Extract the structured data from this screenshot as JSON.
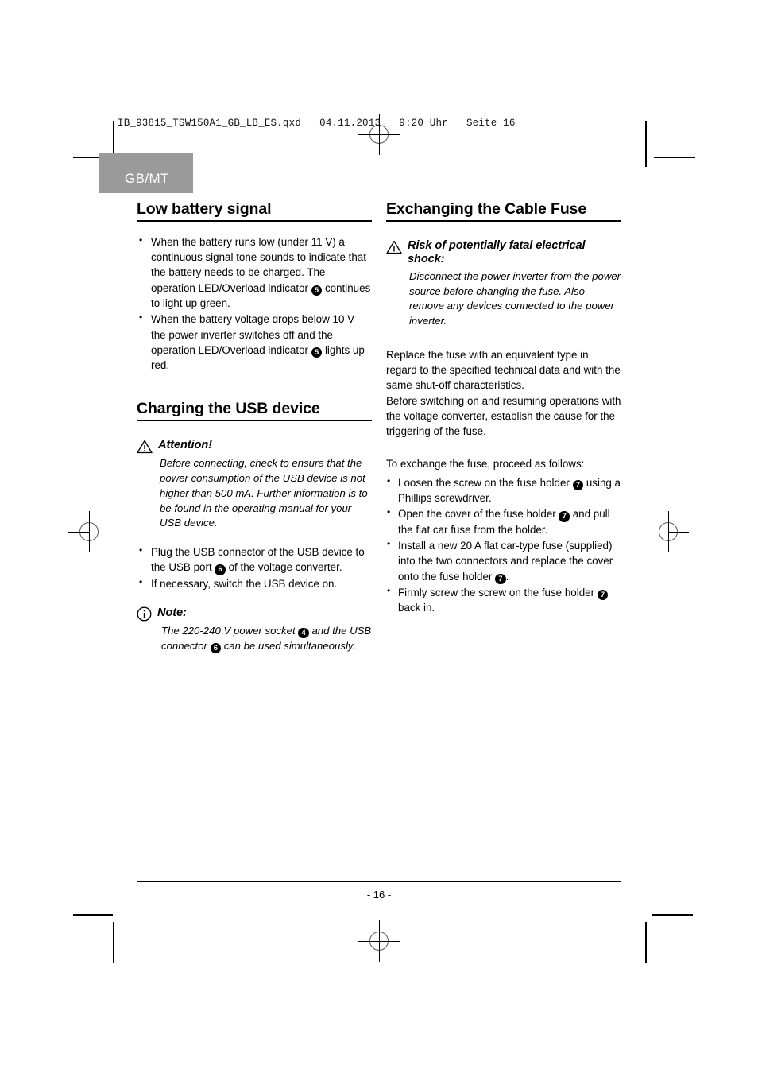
{
  "print_header": "IB_93815_TSW150A1_GB_LB_ES.qxd   04.11.2013   9:20 Uhr   Seite 16",
  "language_tab": "GB/MT",
  "left_column": {
    "section1": {
      "heading": "Low battery signal",
      "bullets": [
        {
          "parts": [
            {
              "t": "text",
              "v": "When the battery runs low (under 11 V) a continuous signal tone sounds to indicate that the battery needs to be charged. The operation LED/Overload indicator "
            },
            {
              "t": "badge",
              "v": "5"
            },
            {
              "t": "text",
              "v": " continues to light up green."
            }
          ]
        },
        {
          "parts": [
            {
              "t": "text",
              "v": "When the battery voltage drops below 10 V the power inverter switches off and the operation LED/Overload indicator "
            },
            {
              "t": "badge",
              "v": "5"
            },
            {
              "t": "text",
              "v": " lights up red."
            }
          ]
        }
      ]
    },
    "section2": {
      "heading": "Charging the USB device",
      "attention": {
        "icon": "warning-triangle-icon",
        "title": "Attention!",
        "body": "Before connecting, check to ensure that the power consumption of the USB device is not higher than 500 mA. Further information is to be found in the operating manual for your USB device."
      },
      "bullets": [
        {
          "parts": [
            {
              "t": "text",
              "v": "Plug the USB connector of the USB device to the USB port "
            },
            {
              "t": "badge",
              "v": "6"
            },
            {
              "t": "text",
              "v": " of the voltage converter."
            }
          ]
        },
        {
          "parts": [
            {
              "t": "text",
              "v": "If necessary, switch the USB device on."
            }
          ]
        }
      ],
      "note": {
        "icon": "info-circle-icon",
        "title": "Note:",
        "parts": [
          {
            "t": "text",
            "v": "The 220-240 V power socket "
          },
          {
            "t": "badge",
            "v": "4"
          },
          {
            "t": "text",
            "v": " and the USB connector "
          },
          {
            "t": "badge",
            "v": "6"
          },
          {
            "t": "text",
            "v": " can be used simultaneously."
          }
        ]
      }
    }
  },
  "right_column": {
    "heading": "Exchanging the Cable Fuse",
    "warning": {
      "icon": "warning-triangle-icon",
      "title": "Risk of potentially fatal electrical shock:",
      "body": "Disconnect the power inverter from the power source before changing the fuse. Also remove any devices connected to the power inverter."
    },
    "paragraphs": [
      "Replace the fuse with an equivalent type in regard to the specified technical data and with the same shut-off characteristics.",
      "Before switching on and resuming operations with the voltage converter, establish the cause for the triggering of the fuse.",
      "To exchange the fuse, proceed as follows:"
    ],
    "bullets": [
      {
        "parts": [
          {
            "t": "text",
            "v": "Loosen the screw on the fuse holder "
          },
          {
            "t": "badge",
            "v": "7"
          },
          {
            "t": "text",
            "v": " using a Phillips screwdriver."
          }
        ]
      },
      {
        "parts": [
          {
            "t": "text",
            "v": "Open the cover of the fuse holder "
          },
          {
            "t": "badge",
            "v": "7"
          },
          {
            "t": "text",
            "v": " and pull the flat car fuse from the holder."
          }
        ]
      },
      {
        "parts": [
          {
            "t": "text",
            "v": "Install a new 20 A flat car-type fuse (supplied) into the two connectors and replace the cover onto the fuse holder "
          },
          {
            "t": "badge",
            "v": "7"
          },
          {
            "t": "text",
            "v": "."
          }
        ]
      },
      {
        "parts": [
          {
            "t": "text",
            "v": "Firmly screw the screw on the fuse holder "
          },
          {
            "t": "badge",
            "v": "7"
          },
          {
            "t": "text",
            "v": " back in."
          }
        ]
      }
    ]
  },
  "footer": {
    "page_number": "- 16 -"
  },
  "colors": {
    "tab_background": "#9a9a9a",
    "tab_text": "#ffffff",
    "text": "#000000",
    "page_background": "#ffffff"
  }
}
